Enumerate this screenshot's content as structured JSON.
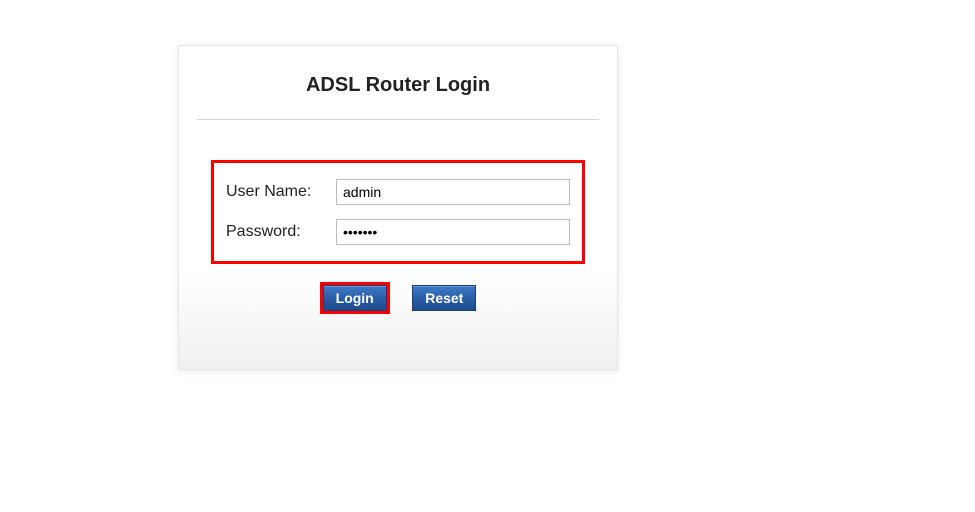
{
  "title": "ADSL Router Login",
  "form": {
    "username_label": "User Name:",
    "username_value": "admin",
    "password_label": "Password:",
    "password_value": "•••••••"
  },
  "buttons": {
    "login": "Login",
    "reset": "Reset"
  }
}
